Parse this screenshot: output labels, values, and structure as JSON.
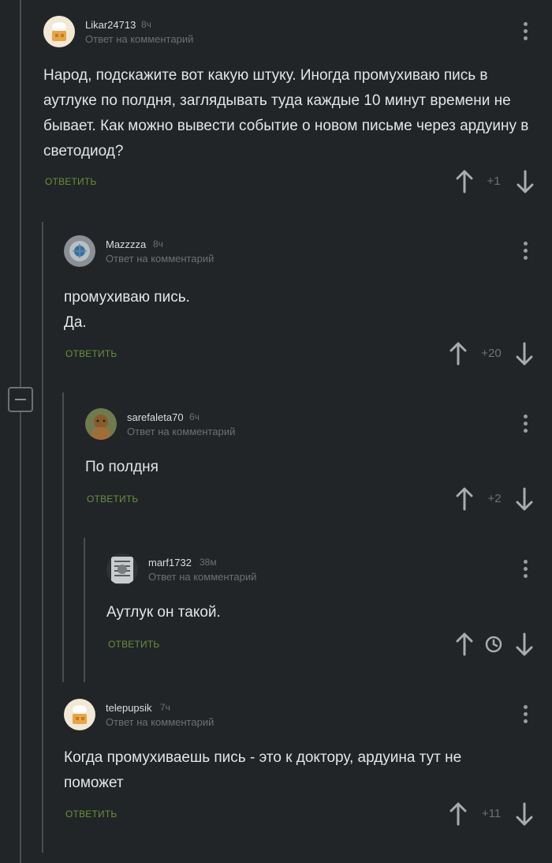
{
  "comments": [
    {
      "username": "Likar24713",
      "time": "8ч",
      "reply_to": "Ответ на комментарий",
      "text": "Народ, подскажите вот какую штуку. Иногда промухиваю пись в аутлуке по полдня, заглядывать туда каждые 10 минут времени не бывает. Как можно вывести событие о новом письме через ардуину в светодиод?",
      "reply_label": "ОТВЕТИТЬ",
      "score": "+1"
    },
    {
      "username": "Mazzzza",
      "time": "8ч",
      "reply_to": "Ответ на комментарий",
      "text": "промухиваю пись.\nДа.",
      "reply_label": "ОТВЕТИТЬ",
      "score": "+20"
    },
    {
      "username": "sarefaleta70",
      "time": "6ч",
      "reply_to": "Ответ на комментарий",
      "text": "По полдня",
      "reply_label": "ОТВЕТИТЬ",
      "score": "+2"
    },
    {
      "username": "marf1732",
      "time": "38м",
      "reply_to": "Ответ на комментарий",
      "text": "Аутлук он такой.",
      "reply_label": "ОТВЕТИТЬ",
      "score_icon": "clock-icon"
    },
    {
      "username": "telepupsik",
      "time": "7ч",
      "reply_to": "Ответ на комментарий",
      "text": "Когда промухиваешь пись - это к доктору, ардуина тут не поможет",
      "reply_label": "ОТВЕТИТЬ",
      "score": "+11"
    }
  ],
  "colors": {
    "background": "#222527",
    "reply_link": "#67903d",
    "muted_text": "#6d7073",
    "thread_line": "#4a4d50"
  }
}
